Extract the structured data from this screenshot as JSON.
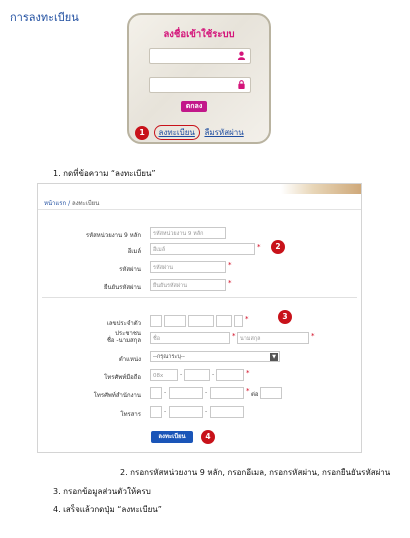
{
  "page": {
    "title": "การลงทะเบียน"
  },
  "login": {
    "heading": "ลงชื่อเข้าใช้ระบบ",
    "submit_label": "ตกลง",
    "callout_number": "1",
    "register_link": "ลงทะเบียน",
    "forgot_link": "ลืมรหัสผ่าน",
    "icons": [
      "user-icon",
      "lock-icon"
    ]
  },
  "steps": {
    "step1": "1.   กดที่ข้อความ “ลงทะเบียน”",
    "step2": "2.   กรอกรหัสหน่วยงาน 9 หลัก, กรอกอีเมล, กรอกรหัสผ่าน, กรอกยืนยันรหัสผ่าน",
    "step3": "3.   กรอกข้อมูลส่วนตัวให้ครบ",
    "step4": "4.   เสร็จแล้วกดปุ่ม “ลงทะเบียน”"
  },
  "registration": {
    "breadcrumb_home": "หน้าแรก",
    "breadcrumb_sep": "/",
    "breadcrumb_current": "ลงทะเบียน",
    "fields": {
      "org_code_label": "รหัสหน่วยงาน 9 หลัก",
      "org_code_placeholder": "รหัสหน่วยงาน 9 หลัก",
      "email_label": "อีเมล์",
      "email_placeholder": "อีเมล์",
      "password_label": "รหัสผ่าน",
      "password_placeholder": "รหัสผ่าน",
      "confirm_label": "ยืนยันรหัสผ่าน",
      "confirm_placeholder": "ยืนยันรหัสผ่าน",
      "id_card_label": "เลขประจำตัวประชาชน",
      "name_label": "ชื่อ -นามสกุล",
      "first_name_placeholder": "ชื่อ",
      "last_name_placeholder": "นามสกุล",
      "position_label": "ตำแหน่ง",
      "position_selected": "--กรุณาระบุ--",
      "mobile_label": "โทรศัพท์มือถือ",
      "mobile_prefix": "08x",
      "office_phone_label": "โทรศัพท์สำนักงาน",
      "ext_label": "ต่อ",
      "fax_label": "โทรสาร"
    },
    "required_mark": "*",
    "dash": "-",
    "submit_label": "ลงทะเบียน",
    "badges": {
      "b2": "2",
      "b3": "3",
      "b4": "4"
    }
  }
}
